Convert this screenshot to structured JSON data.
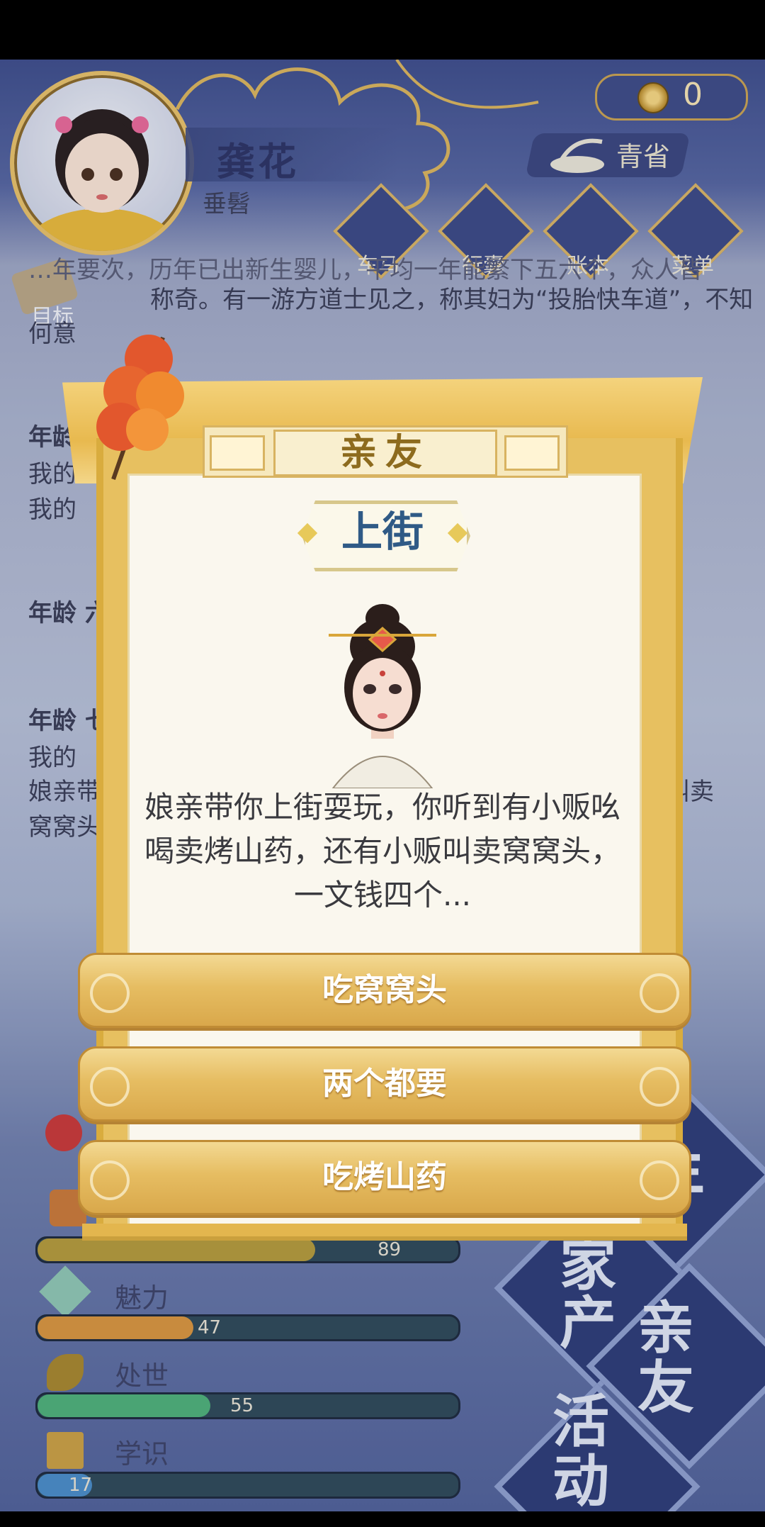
{
  "header": {
    "character_name": "龚花",
    "character_title": "垂髫",
    "coins": "0",
    "province": "青省"
  },
  "nav": {
    "items": [
      {
        "label": "车马",
        "icon": "carriage-icon"
      },
      {
        "label": "行囊",
        "icon": "bag-icon"
      },
      {
        "label": "账本",
        "icon": "ledger-icon"
      },
      {
        "label": "菜单",
        "icon": "menu-icon"
      }
    ],
    "goal_label": "目标"
  },
  "background_log": {
    "line1": "…年要次，历年已出新生婴儿，平均一年能繁下五六个，众人皆",
    "line2": "称奇。有一游方道士见之，称其妇为“投胎快车道”，不知",
    "line3": "何意",
    "age1": "年龄",
    "age1_line1": "我的",
    "age1_line2": "我的",
    "age2": "年龄 六",
    "age3": "年龄 七",
    "age3_line1": "我的",
    "age3_line2": "娘亲带",
    "age3_line2_end": "叫卖",
    "age3_line3": "窝窝头"
  },
  "stats": [
    {
      "name": "",
      "value": "89",
      "fraction": 0.66,
      "color": "#b39b3c"
    },
    {
      "name": "魅力",
      "value": "47",
      "fraction": 0.37,
      "color": "#d7953f"
    },
    {
      "name": "处世",
      "value": "55",
      "fraction": 0.41,
      "color": "#4fb07a"
    },
    {
      "name": "学识",
      "value": "17",
      "fraction": 0.13,
      "color": "#4a8cc7"
    },
    {
      "name": "德行",
      "value": ""
    }
  ],
  "tiles": {
    "t1": "年",
    "t2": "家产",
    "t3": "亲友",
    "t4": "活动"
  },
  "modal": {
    "header": "亲友",
    "event_title": "上街",
    "story": "娘亲带你上街耍玩，你听到有小贩吆喝卖烤山药，还有小贩叫卖窝窝头，一文钱四个...",
    "choices": [
      "吃窝窝头",
      "两个都要",
      "吃烤山药"
    ]
  },
  "colors": {
    "gold": "#e6bd62",
    "navy": "#2e3d78",
    "title_blue": "#2f5a86"
  }
}
